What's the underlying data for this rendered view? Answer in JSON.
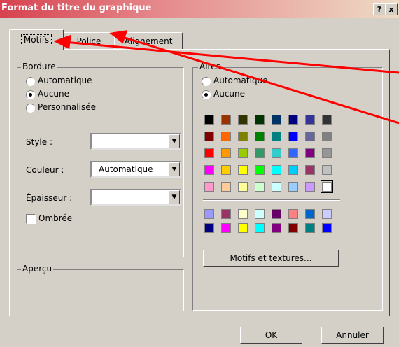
{
  "window": {
    "title": "Format du titre du graphique",
    "help_label": "?",
    "close_label": "x"
  },
  "tabs": [
    {
      "label": "Motifs",
      "active": true
    },
    {
      "label": "Police",
      "active": false
    },
    {
      "label": "Alignement",
      "active": false
    }
  ],
  "bordure": {
    "legend": "Bordure",
    "options": [
      {
        "label": "Automatique",
        "selected": false
      },
      {
        "label": "Aucune",
        "selected": true
      },
      {
        "label": "Personnalisée",
        "selected": false
      }
    ],
    "style_label": "Style :",
    "couleur_label": "Couleur :",
    "couleur_value": "Automatique",
    "epaisseur_label": "Épaisseur :",
    "ombree_label": "Ombrée",
    "ombree_checked": false
  },
  "apercu": {
    "legend": "Aperçu"
  },
  "aires": {
    "legend": "Aires",
    "options": [
      {
        "label": "Automatique",
        "selected": false
      },
      {
        "label": "Aucune",
        "selected": true
      }
    ],
    "palette_main": [
      [
        "#000000",
        "#993300",
        "#333300",
        "#003300",
        "#003366",
        "#000080",
        "#333399",
        "#333333"
      ],
      [
        "#800000",
        "#FF6600",
        "#808000",
        "#008000",
        "#008080",
        "#0000FF",
        "#666699",
        "#808080"
      ],
      [
        "#FF0000",
        "#FF9900",
        "#99CC00",
        "#339966",
        "#33CCCC",
        "#3366FF",
        "#800080",
        "#969696"
      ],
      [
        "#FF00FF",
        "#FFCC00",
        "#FFFF00",
        "#00FF00",
        "#00FFFF",
        "#00CCFF",
        "#993366",
        "#C0C0C0"
      ],
      [
        "#FF99CC",
        "#FFCC99",
        "#FFFF99",
        "#CCFFCC",
        "#CCFFFF",
        "#99CCFF",
        "#CC99FF",
        "#FFFFFF"
      ]
    ],
    "palette_chart": [
      [
        "#9999FF",
        "#993366",
        "#FFFFCC",
        "#CCFFFF",
        "#660066",
        "#FF8080",
        "#0066CC",
        "#CCCCFF"
      ],
      [
        "#000080",
        "#FF00FF",
        "#FFFF00",
        "#00FFFF",
        "#800080",
        "#800000",
        "#008080",
        "#0000FF"
      ]
    ],
    "motifs_button": "Motifs et textures..."
  },
  "footer": {
    "ok_label": "OK",
    "cancel_label": "Annuler"
  },
  "annotation": {
    "arrow_color": "#ff0000"
  }
}
